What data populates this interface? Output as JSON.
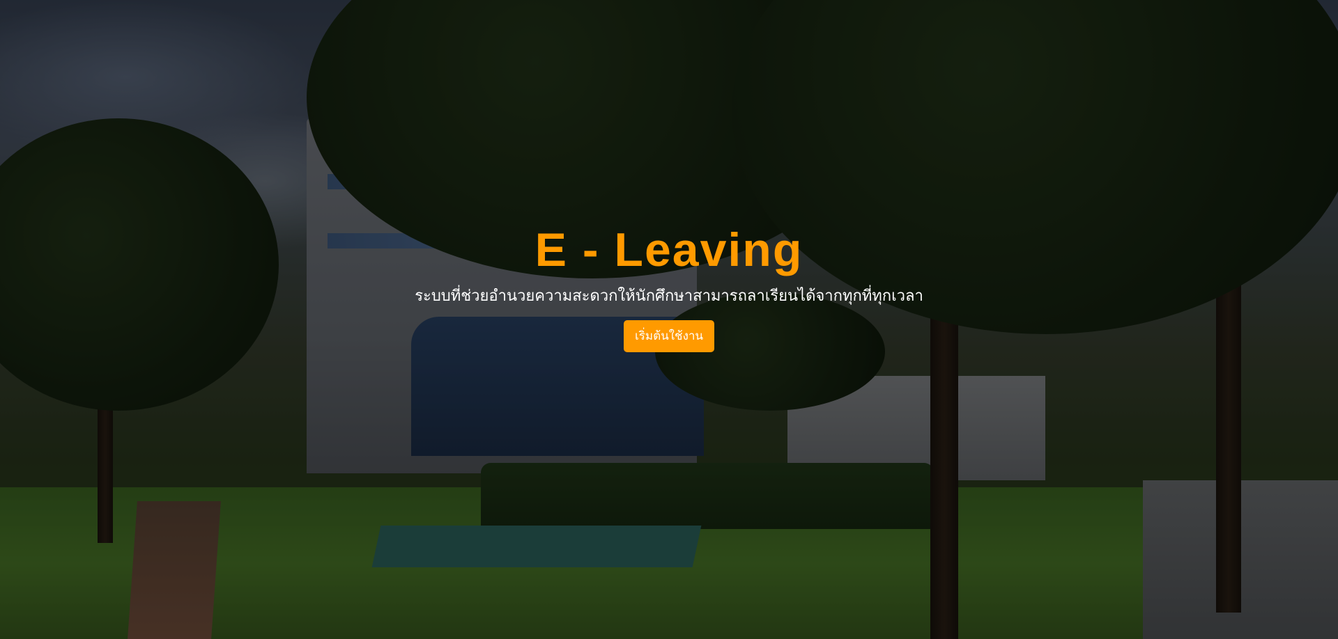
{
  "hero": {
    "title": "E - Leaving",
    "subtitle": "ระบบที่ช่วยอำนวยความสะดวกให้นักศึกษาสามารถลาเรียนได้จากทุกที่ทุกเวลา",
    "cta_label": "เริ่มต้นใช้งาน"
  },
  "colors": {
    "accent": "#ff9a00",
    "text": "#ffffff",
    "overlay": "rgba(0,0,0,0.42)"
  }
}
